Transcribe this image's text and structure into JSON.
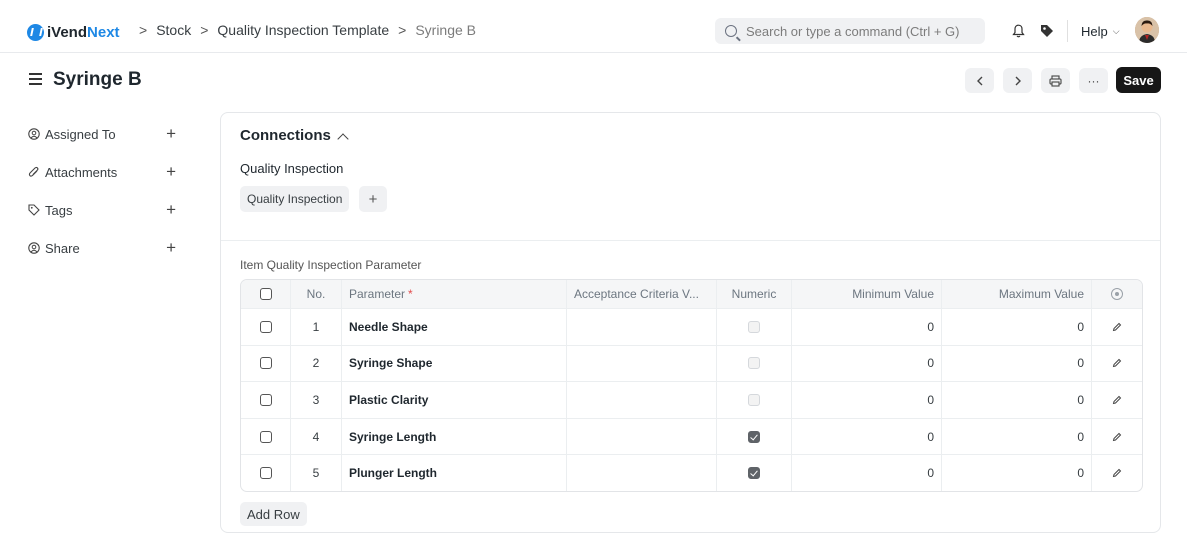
{
  "brand": {
    "part1": "iVend",
    "part2": "Next",
    "accent": "#1e88e5"
  },
  "breadcrumbs": {
    "item1": "Stock",
    "item2": "Quality Inspection Template",
    "current": "Syringe B",
    "separator": ">"
  },
  "search": {
    "placeholder": "Search or type a command (Ctrl + G)"
  },
  "navbar": {
    "help_label": "Help",
    "help_chevron": "⌵"
  },
  "page": {
    "title": "Syringe B",
    "save_label": "Save",
    "more_label": "···"
  },
  "sidebar": {
    "items": [
      {
        "label": "Assigned To",
        "icon": "assign-icon",
        "add": "+"
      },
      {
        "label": "Attachments",
        "icon": "paperclip-icon",
        "add": "+"
      },
      {
        "label": "Tags",
        "icon": "tag-icon",
        "add": "+"
      },
      {
        "label": "Share",
        "icon": "share-icon",
        "add": "+"
      }
    ]
  },
  "connections": {
    "title": "Connections",
    "group_label": "Quality Inspection",
    "chip_label": "Quality Inspection",
    "add_label": "+"
  },
  "table": {
    "label": "Item Quality Inspection Parameter",
    "columns": {
      "no": "No.",
      "parameter": "Parameter",
      "required": "*",
      "acceptance": "Acceptance Criteria V...",
      "numeric": "Numeric",
      "min": "Minimum Value",
      "max": "Maximum Value"
    },
    "rows": [
      {
        "no": "1",
        "parameter": "Needle Shape",
        "acceptance": "",
        "numeric": false,
        "min": "0",
        "max": "0"
      },
      {
        "no": "2",
        "parameter": "Syringe Shape",
        "acceptance": "",
        "numeric": false,
        "min": "0",
        "max": "0"
      },
      {
        "no": "3",
        "parameter": "Plastic Clarity",
        "acceptance": "",
        "numeric": false,
        "min": "0",
        "max": "0"
      },
      {
        "no": "4",
        "parameter": "Syringe Length",
        "acceptance": "",
        "numeric": true,
        "min": "0",
        "max": "0"
      },
      {
        "no": "5",
        "parameter": "Plunger Length",
        "acceptance": "",
        "numeric": true,
        "min": "0",
        "max": "0"
      }
    ],
    "add_row_label": "Add Row"
  },
  "colors": {
    "save_bg": "#171717",
    "required": "#e24c4c",
    "checked": "#5f6368"
  }
}
